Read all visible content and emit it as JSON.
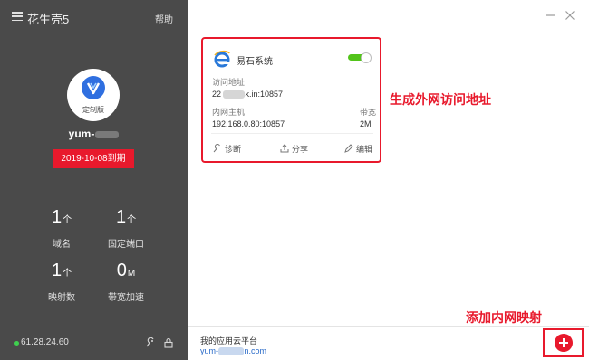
{
  "sidebar": {
    "title": "花生壳5",
    "help": "帮助",
    "avatar_caption": "定制版",
    "username": "yum-",
    "expire": "2019-10-08到期",
    "stats": [
      {
        "value": "1",
        "unit": "个",
        "label": "域名"
      },
      {
        "value": "1",
        "unit": "个",
        "label": "固定端口"
      },
      {
        "value": "1",
        "unit": "个",
        "label": "映射数"
      },
      {
        "value": "0",
        "unit": "M",
        "label": "带宽加速"
      }
    ],
    "ip": "61.28.24.60"
  },
  "card": {
    "name": "易石系统",
    "enabled": true,
    "access_label": "访问地址",
    "access_value": "22       20.iask.in:10857",
    "host_label": "内网主机",
    "bandwidth_label": "带宽",
    "host_value": "192.168.0.80:10857",
    "bandwidth_value": "2M",
    "actions": {
      "diagnose": "诊断",
      "share": "分享",
      "edit": "编辑"
    }
  },
  "annotations": {
    "generate": "生成外网访问地址",
    "add": "添加内网映射"
  },
  "bottom": {
    "title": "我的应用云平台",
    "link": "yum-        .hskyun.com"
  },
  "colors": {
    "accent_red": "#e8192c",
    "sidebar_bg": "#4a4a4a",
    "toggle_on": "#52c41a",
    "link_blue": "#2a6bc9"
  }
}
